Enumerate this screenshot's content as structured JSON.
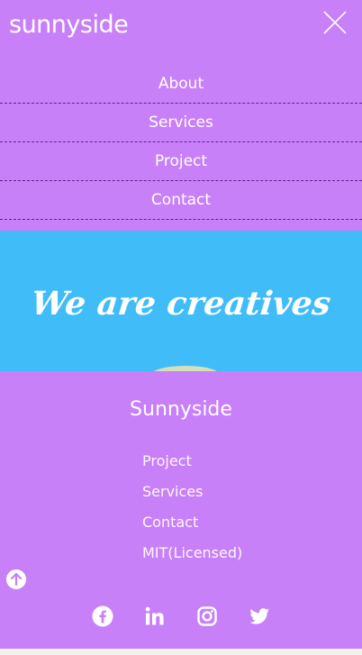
{
  "header": {
    "logo": "sunnyside",
    "close_icon": "close-icon",
    "nav_items": [
      {
        "label": "About"
      },
      {
        "label": "Services"
      },
      {
        "label": "Project"
      },
      {
        "label": "Contact"
      }
    ]
  },
  "hero": {
    "title": "We are creatives"
  },
  "footer": {
    "brand": "Sunnyside",
    "links": [
      {
        "label": "Project"
      },
      {
        "label": "Services"
      },
      {
        "label": "Contact"
      },
      {
        "label": "MIT(Licensed)"
      }
    ],
    "scroll_up_icon": "arrow-up-circle-icon",
    "socials": [
      {
        "icon": "facebook-icon"
      },
      {
        "icon": "linkedin-icon"
      },
      {
        "icon": "instagram-icon"
      },
      {
        "icon": "twitter-icon"
      }
    ]
  },
  "colors": {
    "purple": "#c880f8",
    "blue": "#40bcf8",
    "white": "#ffffff"
  }
}
